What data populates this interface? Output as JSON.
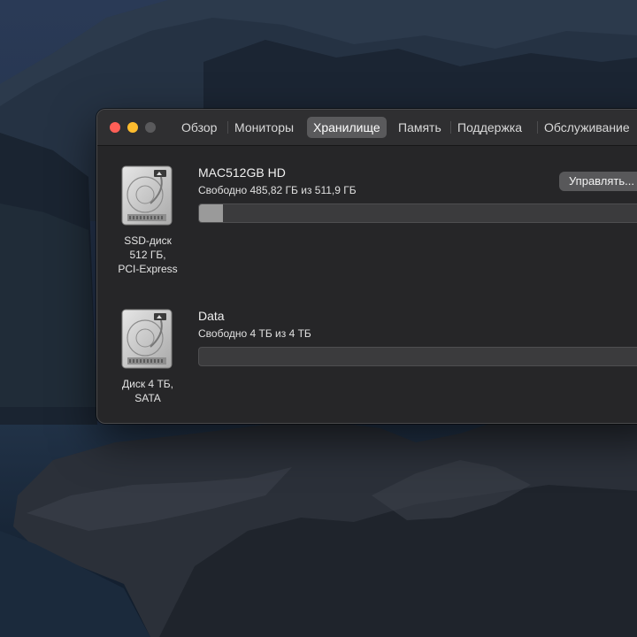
{
  "window": {
    "tabs": [
      {
        "label": "Обзор"
      },
      {
        "label": "Мониторы"
      },
      {
        "label": "Хранилище"
      },
      {
        "label": "Память"
      },
      {
        "label": "Поддержка"
      },
      {
        "label": "Обслуживание"
      }
    ],
    "active_tab": "Хранилище"
  },
  "disks": [
    {
      "name": "MAC512GB HD",
      "free_text": "Свободно 485,82 ГБ из 511,9 ГБ",
      "caption": [
        "SSD-диск",
        "512 ГБ,",
        "PCI-Express"
      ],
      "used_fraction": 0.05,
      "manage_label": "Управлять..."
    },
    {
      "name": "Data",
      "free_text": "Свободно 4 ТБ из 4 ТБ",
      "caption": [
        "Диск 4 ТБ,",
        "SATA"
      ],
      "used_fraction": 0.0
    }
  ],
  "icons": {
    "disk": "hard-drive-icon"
  },
  "colors": {
    "close": "#ff5f57",
    "minimize": "#febc2e",
    "zoom_disabled": "#5a5a5c",
    "used_storage": "#9a9a9a"
  }
}
